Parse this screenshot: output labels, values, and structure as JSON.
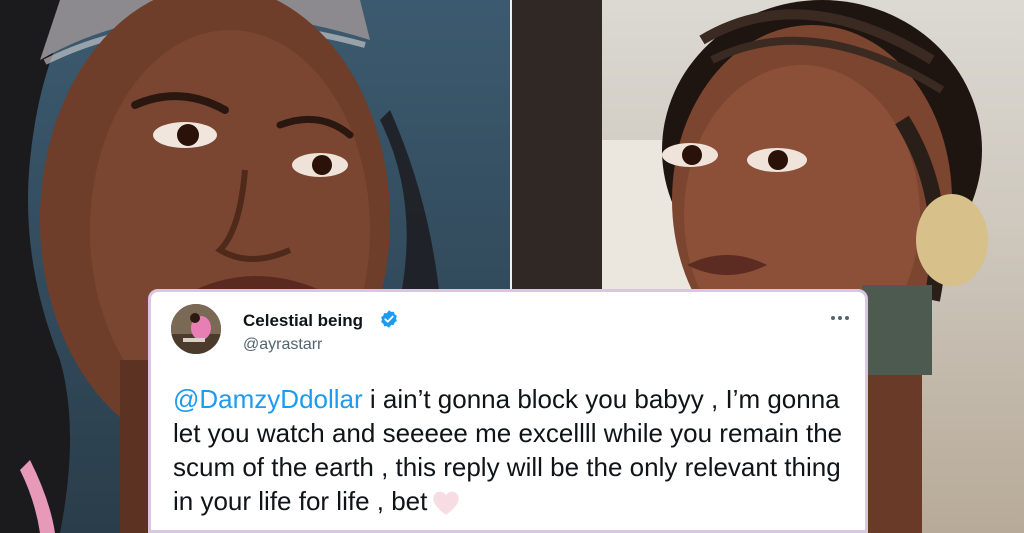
{
  "tweet": {
    "display_name": "Celestial being",
    "handle": "@ayrastarr",
    "verified": true,
    "mention": "@DamzyDdollar",
    "text": " i ain’t gonna block you babyy , I’m gonna let you watch and seeeee me excellll while you remain the scum of the earth , this reply will be the only relevant thing in your life for life , bet",
    "emoji": "heart-icon",
    "more_icon": "more-options-icon"
  },
  "colors": {
    "mention": "#1d9bf0",
    "verified_badge": "#1d9bf0",
    "border": "#d9c6df",
    "heart": "#f7dde3"
  }
}
